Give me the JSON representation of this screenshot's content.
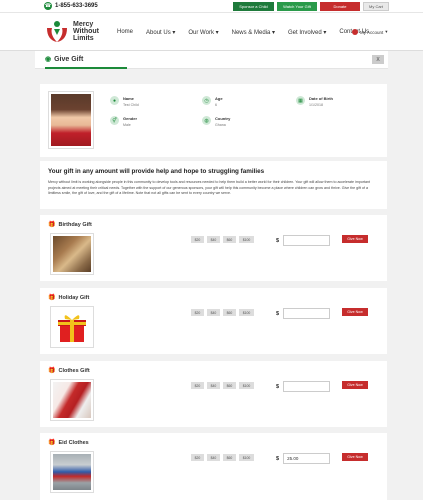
{
  "topbar": {
    "phone": "1-855-633-3695",
    "buttons": [
      "Sponsor a Child",
      "Watch Your Gift",
      "Donate",
      "My Cart"
    ]
  },
  "nav": {
    "logo": "Mercy Without Limits",
    "items": [
      "Home",
      "About Us",
      "Our Work",
      "News & Media",
      "Get Involved",
      "Contact Us"
    ],
    "account": "My Account"
  },
  "page": {
    "title": "Give Gift",
    "close": "X"
  },
  "child": {
    "name_label": "Name",
    "name_value": "Test Child",
    "age_label": "Age",
    "age_value": "6",
    "dob_label": "Date of Birth",
    "dob_value": "1/1/2018",
    "gender_label": "Gender",
    "gender_value": "Male",
    "country_label": "Country",
    "country_value": "Ghana"
  },
  "description": {
    "title": "Your gift in any amount will provide help and hope to struggling families",
    "text": "Mercy without limit is working alongside people in this community to develop tools and resources needed to help them build a better world for their children. Your gift will allow them to accelerate important projects aimed at meeting their critical needs. Together with the support of our generous sponsors, your gift will help this community become a place where children can grow and thrive. Give the gift of a limitless smile, the gift of love, and the gift of a lifetime. Note that not all gifts can be sent to every country we serve."
  },
  "gifts": [
    {
      "title": "Birthday Gift",
      "amounts": [
        "$20",
        "$40",
        "$60",
        "$100"
      ],
      "value": "",
      "button": "Give Now"
    },
    {
      "title": "Holiday Gift",
      "amounts": [
        "$20",
        "$40",
        "$60",
        "$100"
      ],
      "value": "",
      "button": "Give Now"
    },
    {
      "title": "Clothes Gift",
      "amounts": [
        "$20",
        "$40",
        "$60",
        "$100"
      ],
      "value": "",
      "button": "Give Now"
    },
    {
      "title": "Eid Clothes",
      "amounts": [
        "$20",
        "$40",
        "$60",
        "$100"
      ],
      "value": "25.00",
      "button": "Give Now"
    }
  ],
  "currency": "$",
  "colors": {
    "brand_green": "#1c8a3a",
    "brand_red": "#c62d2d"
  }
}
